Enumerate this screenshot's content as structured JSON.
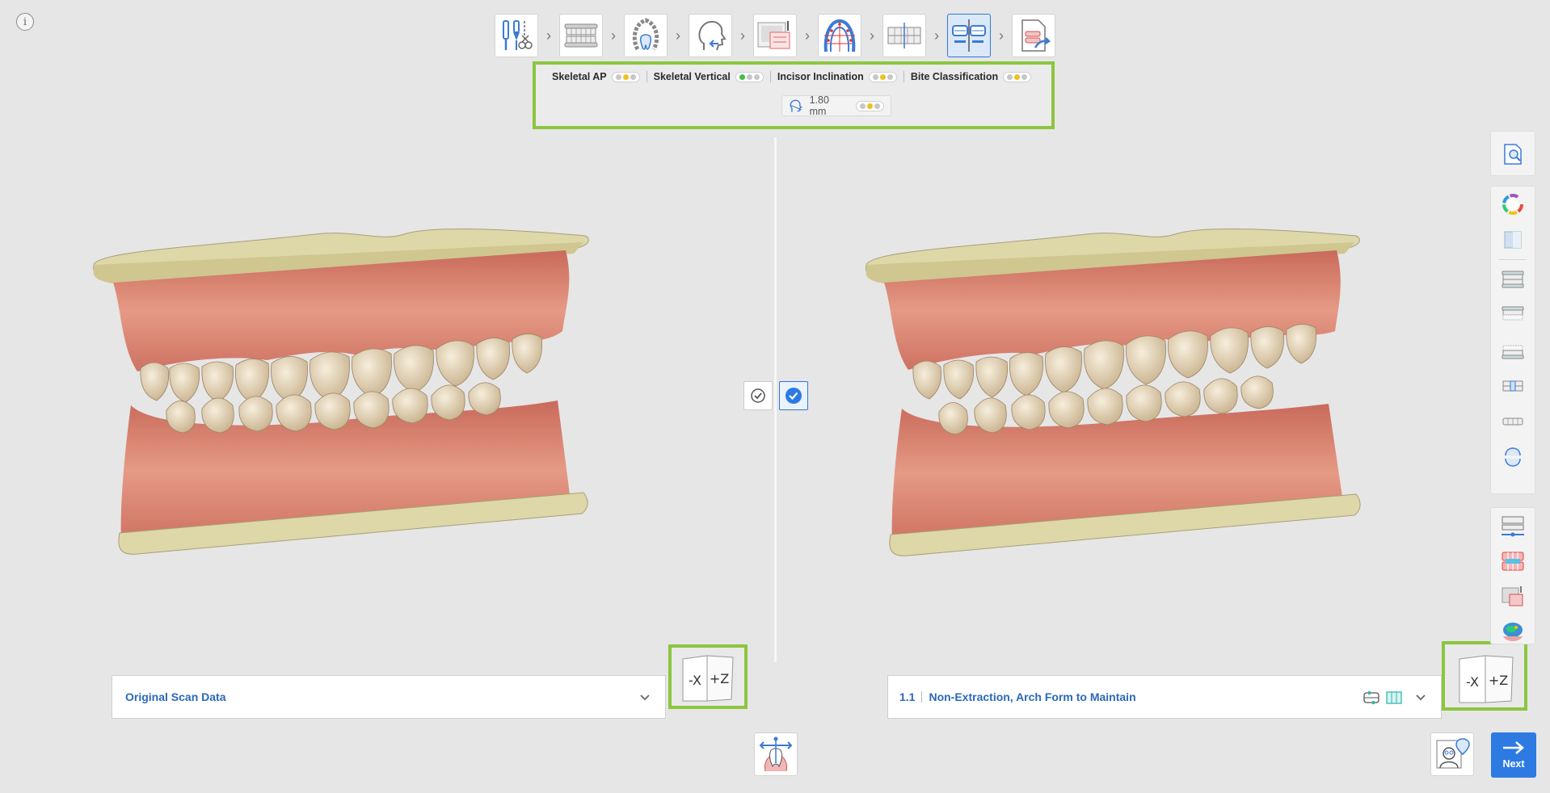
{
  "info": {
    "glyph": "i"
  },
  "workflow": {
    "steps": [
      {
        "icon": "tools-cut-icon"
      },
      {
        "icon": "dental-arches-icon"
      },
      {
        "icon": "tooth-segmentation-icon"
      },
      {
        "icon": "head-profile-icon"
      },
      {
        "icon": "image-overlay-icon"
      },
      {
        "icon": "arch-form-icon"
      },
      {
        "icon": "teeth-alignment-icon"
      },
      {
        "icon": "treatment-compare-icon",
        "active": true
      },
      {
        "icon": "export-report-icon"
      }
    ],
    "arrow": "›"
  },
  "ceph": {
    "items": [
      {
        "label": "Skeletal AP",
        "dots": [
          "gray",
          "yellow",
          "gray"
        ]
      },
      {
        "label": "Skeletal Vertical",
        "dots": [
          "green",
          "gray",
          "gray"
        ]
      },
      {
        "label": "Incisor Inclination",
        "dots": [
          "gray",
          "yellow",
          "gray"
        ]
      },
      {
        "label": "Bite Classification",
        "dots": [
          "gray",
          "yellow",
          "gray"
        ]
      }
    ],
    "measure": {
      "value": "1.80 mm",
      "dots": [
        "gray",
        "yellow",
        "gray"
      ]
    }
  },
  "left_panel": {
    "dropdown_label": "Original Scan Data"
  },
  "right_panel": {
    "number": "1.1",
    "dropdown_label": "Non-Extraction, Arch Form to Maintain"
  },
  "view_cube": {
    "left_face": "-X",
    "right_face": "+Z"
  },
  "next_button": {
    "label": "Next",
    "icon": "arrow-right-icon"
  },
  "colors": {
    "accent": "#2d7ae3",
    "highlight": "#8cc63f",
    "gum": "#d98472",
    "base": "#e3dcae",
    "tooth": "#e8dcc0"
  }
}
